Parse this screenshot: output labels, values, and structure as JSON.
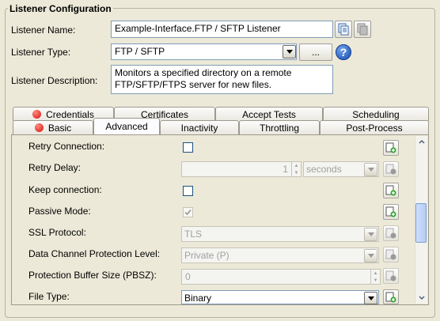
{
  "section_title": "Listener Configuration",
  "listener_name": {
    "label": "Listener Name:",
    "value": "Example-Interface.FTP / SFTP Listener"
  },
  "listener_type": {
    "label": "Listener Type:",
    "value": "FTP / SFTP",
    "browse_label": "..."
  },
  "listener_description": {
    "label": "Listener Description:",
    "value_line1": "Monitors a specified directory on a remote",
    "value_line2": "FTP/SFTP/FTPS server for new files."
  },
  "help_icon": "?",
  "tabs_row1": [
    {
      "label": "Credentials",
      "error": true
    },
    {
      "label": "Certificates",
      "error": false
    },
    {
      "label": "Accept Tests",
      "error": false
    },
    {
      "label": "Scheduling",
      "error": false
    }
  ],
  "tabs_row2": [
    {
      "label": "Basic",
      "error": true
    },
    {
      "label": "Advanced",
      "active": true
    },
    {
      "label": "Inactivity"
    },
    {
      "label": "Throttling"
    },
    {
      "label": "Post-Process"
    }
  ],
  "advanced": {
    "retry_connection": {
      "label": "Retry Connection:",
      "checked": false
    },
    "retry_delay": {
      "label": "Retry Delay:",
      "value": "1",
      "unit": "seconds"
    },
    "keep_connection": {
      "label": "Keep connection:",
      "checked": false
    },
    "passive_mode": {
      "label": "Passive Mode:",
      "checked": true
    },
    "ssl_protocol": {
      "label": "SSL Protocol:",
      "value": "TLS"
    },
    "data_channel_protection": {
      "label": "Data Channel Protection Level:",
      "value": "Private (P)"
    },
    "pbsz": {
      "label": "Protection Buffer Size (PBSZ):",
      "value": "0"
    },
    "file_type": {
      "label": "File Type:",
      "value": "Binary"
    }
  },
  "icons": {
    "copy": "copy-icon",
    "variable": "add-variable-icon",
    "help": "help-icon",
    "error": "error-dot-icon"
  },
  "colors": {
    "error_red": "#d9100b",
    "help_blue": "#1b4fb5",
    "thumb_blue": "#b6cdf4"
  }
}
